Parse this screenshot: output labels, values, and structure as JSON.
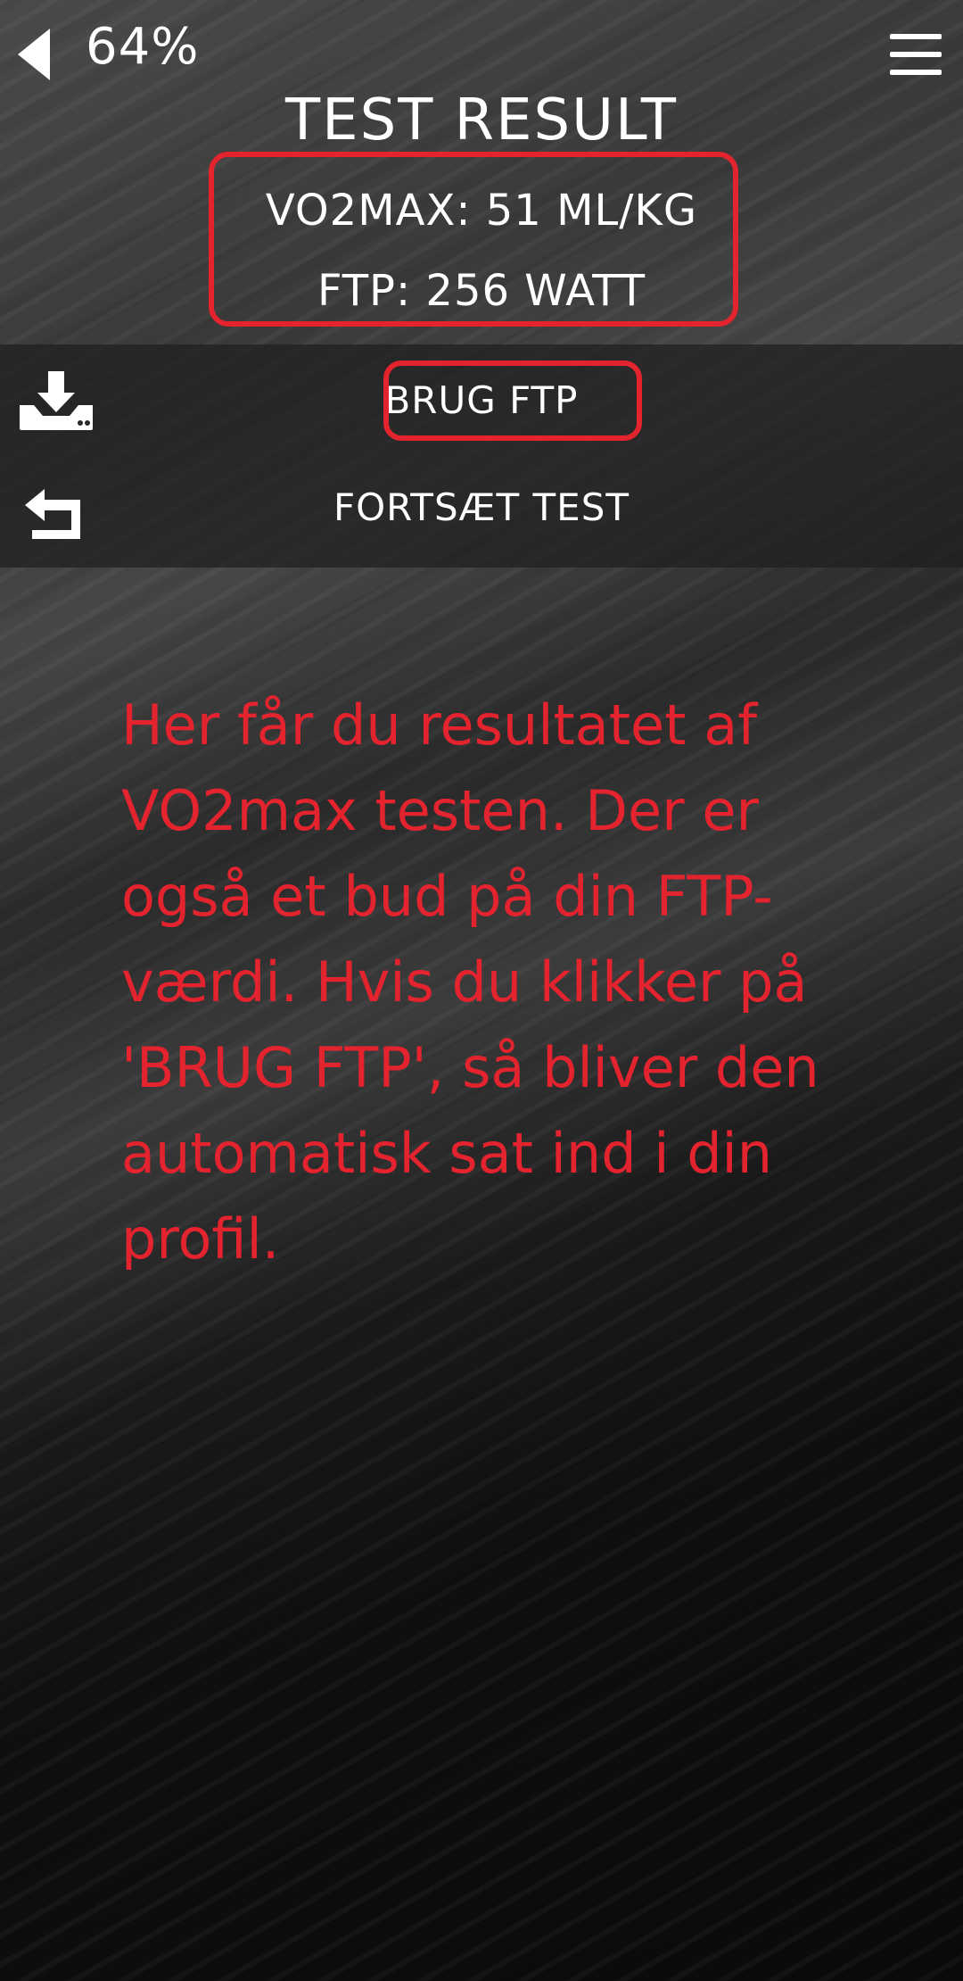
{
  "status": {
    "battery": "64%"
  },
  "header": {
    "title": "TEST RESULT",
    "vo2max": "VO2MAX: 51 ML/KG",
    "ftp": "FTP: 256 WATT"
  },
  "actions": {
    "use_ftp": {
      "label": "BRUG FTP",
      "icon": "download-tray-icon"
    },
    "continue_test": {
      "label": "FORTSÆT TEST",
      "icon": "undo-arrow-icon"
    }
  },
  "info_text": "Her får du resultatet af VO2max testen. Der er også et bud på din FTP-værdi. Hvis du klikker på 'BRUG FTP', så bliver den automatisk sat ind i din profil.",
  "colors": {
    "accent": "#e3232e",
    "text": "#ffffff"
  }
}
